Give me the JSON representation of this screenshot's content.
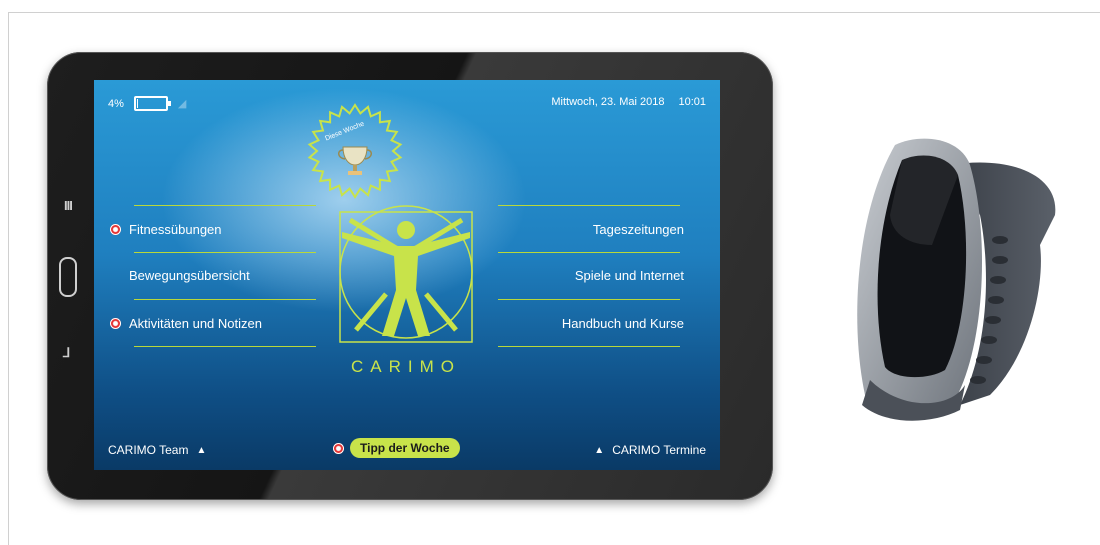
{
  "status": {
    "battery_percent_label": "4%",
    "battery_level": 0.04,
    "date": "Mittwoch, 23. Mai 2018",
    "time": "10:01"
  },
  "badge": {
    "text": "Diese Woche"
  },
  "menu_left": [
    {
      "label": "Fitnessübungen",
      "notification": true
    },
    {
      "label": "Bewegungsübersicht",
      "notification": false
    },
    {
      "label": "Aktivitäten und Notizen",
      "notification": true
    }
  ],
  "menu_right": [
    {
      "label": "Tageszeitungen"
    },
    {
      "label": "Spiele und Internet"
    },
    {
      "label": "Handbuch und Kurse"
    }
  ],
  "logo": {
    "text": "CARIMO"
  },
  "bottom": {
    "team_label": "CARIMO Team",
    "tipp_label": "Tipp der Woche",
    "termine_label": "CARIMO Termine"
  },
  "colors": {
    "accent": "#c8e34a",
    "screen_top": "#2a9ad6",
    "screen_bottom": "#0a3a66",
    "notification": "#e53030"
  },
  "icons": [
    "menu-icon",
    "home-icon",
    "back-icon",
    "battery-icon",
    "signal-icon",
    "trophy-icon",
    "triangle-up-icon"
  ]
}
